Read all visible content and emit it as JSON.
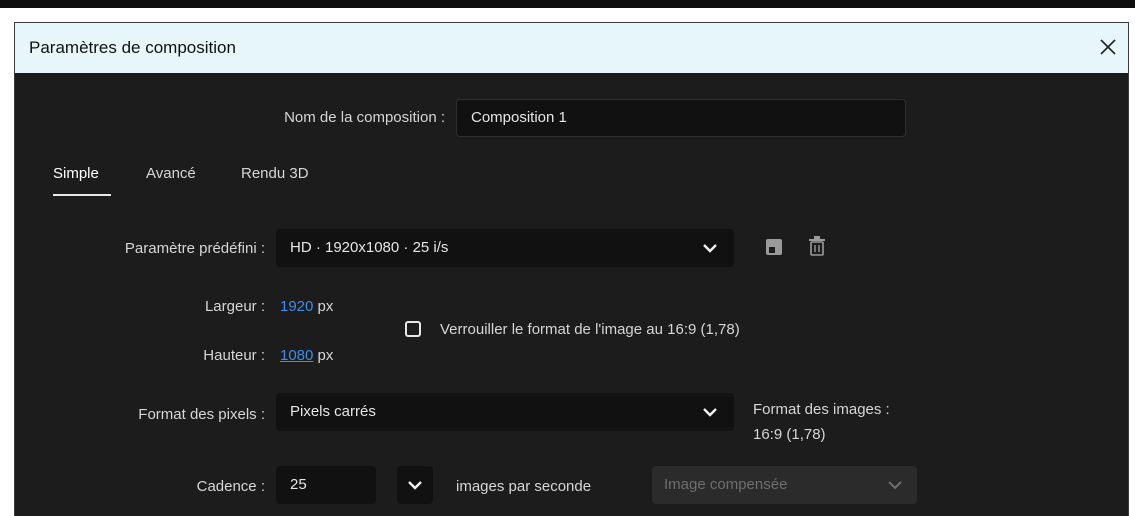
{
  "dialog": {
    "title": "Paramètres de composition",
    "close_icon": "close-icon"
  },
  "name_field": {
    "label": "Nom de la composition :",
    "value": "Composition 1"
  },
  "tabs": [
    {
      "label": "Simple",
      "active": true
    },
    {
      "label": "Avancé",
      "active": false
    },
    {
      "label": "Rendu 3D",
      "active": false
    }
  ],
  "preset": {
    "label": "Paramètre prédéfini :",
    "value": "HD · 1920x1080 · 25 i/s",
    "save_icon": "save-preset-icon",
    "delete_icon": "trash-icon"
  },
  "width": {
    "label": "Largeur :",
    "value": "1920",
    "unit": "px"
  },
  "height": {
    "label": "Hauteur :",
    "value": "1080",
    "unit": "px"
  },
  "lock_aspect": {
    "label": "Verrouiller le format de l'image au 16:9 (1,78)",
    "checked": false
  },
  "pixel_aspect": {
    "label": "Format des pixels :",
    "value": "Pixels carrés",
    "frame_aspect_label": "Format des images :",
    "frame_aspect_value": "16:9 (1,78)"
  },
  "frame_rate": {
    "label": "Cadence :",
    "value": "25",
    "unit_label": "images par seconde",
    "mode_placeholder": "Image compensée"
  },
  "colors": {
    "accent": "#3b8ef0",
    "background": "#1c1c1c",
    "field": "#111111"
  }
}
